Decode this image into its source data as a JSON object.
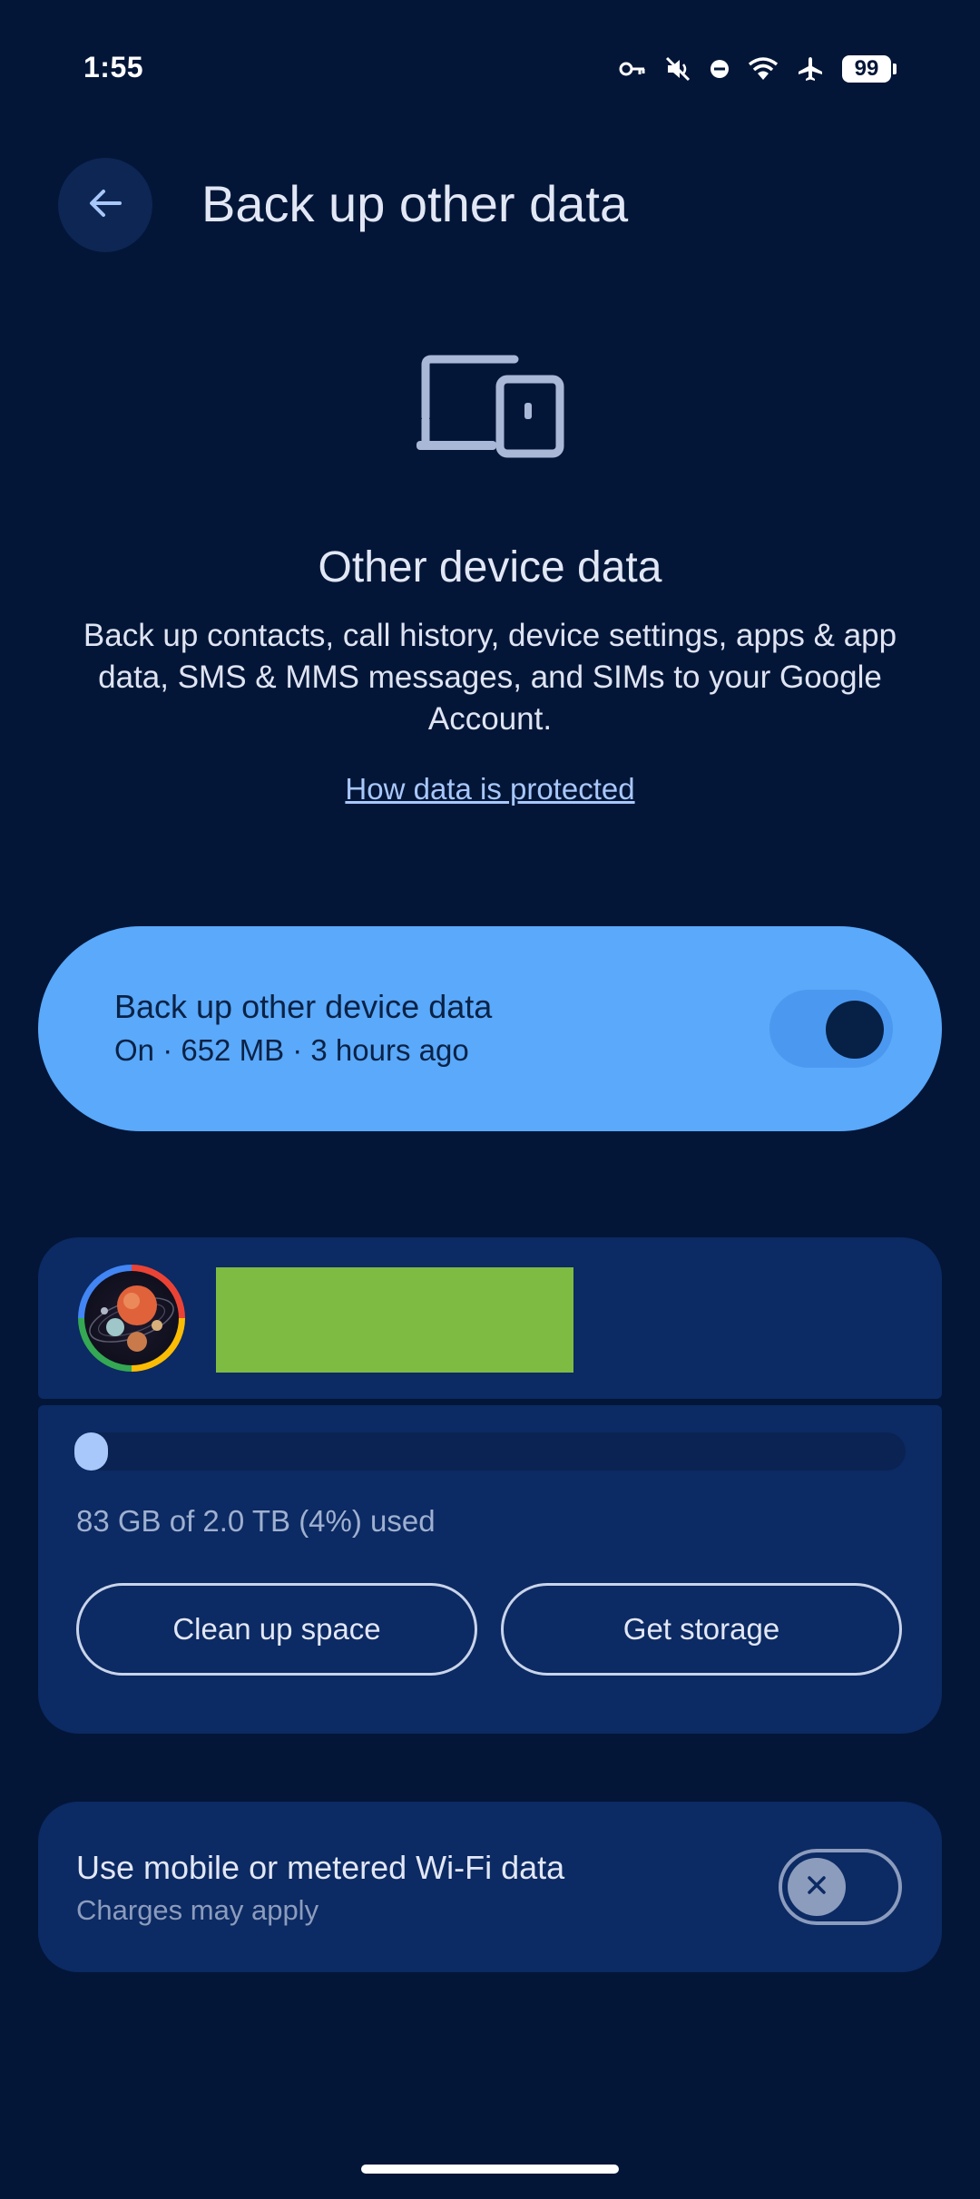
{
  "status_bar": {
    "time": "1:55",
    "battery": "99",
    "icons": [
      "vpn-key-icon",
      "mute-icon",
      "do-not-disturb-icon",
      "wifi-icon",
      "airplane-icon",
      "battery-icon"
    ]
  },
  "header": {
    "title": "Back up other data",
    "back_icon": "arrow-back-icon"
  },
  "hero": {
    "icon": "devices-icon",
    "title": "Other device data",
    "description": "Back up contacts, call history, device settings, apps & app data, SMS & MMS messages, and SIMs to your Google Account.",
    "link": "How data is protected"
  },
  "backup_toggle": {
    "label": "Back up other device data",
    "status": "On · 652 MB · 3 hours ago",
    "enabled": true
  },
  "storage": {
    "usage_text": "83 GB of 2.0 TB (4%) used",
    "used_fraction": 0.04,
    "clean_label": "Clean up space",
    "get_label": "Get storage"
  },
  "metered": {
    "label": "Use mobile or metered Wi-Fi data",
    "sub": "Charges may apply",
    "enabled": false
  },
  "colors": {
    "background": "#031638",
    "accent": "#5aa9fa",
    "card": "#0c2a63",
    "link": "#a8c7fa"
  }
}
